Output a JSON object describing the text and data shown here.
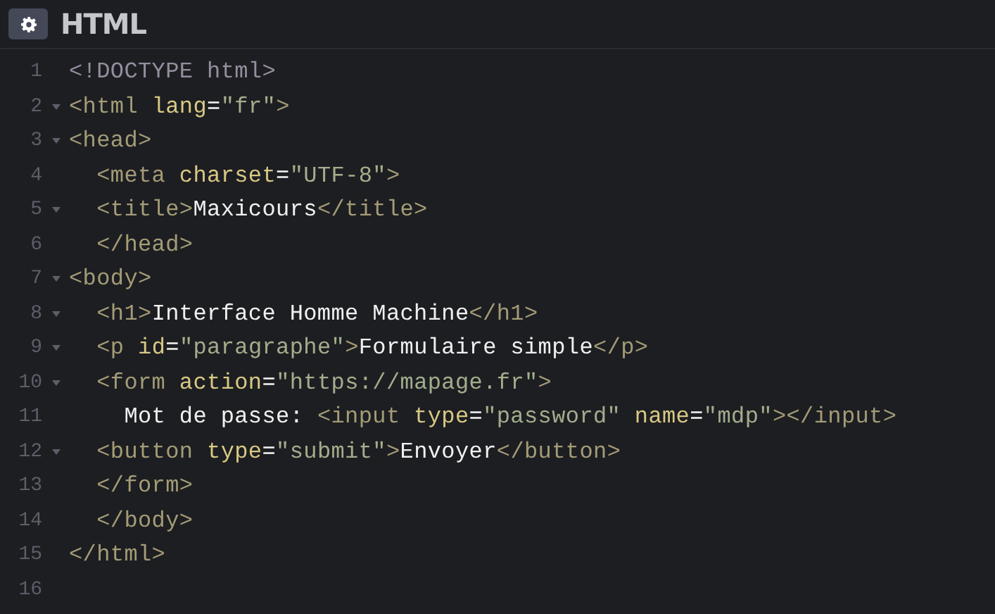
{
  "editor": {
    "title": "HTML"
  },
  "lines": [
    {
      "number": "1",
      "foldable": false,
      "tokens": [
        {
          "kind": "doctype",
          "text": "<!DOCTYPE html>"
        }
      ]
    },
    {
      "number": "2",
      "foldable": true,
      "tokens": [
        {
          "kind": "tag",
          "text": "<html"
        },
        {
          "kind": "attr",
          "text": " lang"
        },
        {
          "kind": "text",
          "text": "="
        },
        {
          "kind": "value",
          "text": "\"fr\""
        },
        {
          "kind": "tag",
          "text": ">"
        }
      ]
    },
    {
      "number": "3",
      "foldable": true,
      "tokens": [
        {
          "kind": "tag",
          "text": "<head>"
        }
      ]
    },
    {
      "number": "4",
      "foldable": false,
      "tokens": [
        {
          "kind": "tag",
          "text": "  <meta"
        },
        {
          "kind": "attr",
          "text": " charset"
        },
        {
          "kind": "text",
          "text": "="
        },
        {
          "kind": "value",
          "text": "\"UTF-8\""
        },
        {
          "kind": "tag",
          "text": ">"
        }
      ]
    },
    {
      "number": "5",
      "foldable": true,
      "tokens": [
        {
          "kind": "tag",
          "text": "  <title>"
        },
        {
          "kind": "text",
          "text": "Maxicours"
        },
        {
          "kind": "tag",
          "text": "</title>"
        }
      ]
    },
    {
      "number": "6",
      "foldable": false,
      "tokens": [
        {
          "kind": "tag",
          "text": "  </head>"
        }
      ]
    },
    {
      "number": "7",
      "foldable": true,
      "tokens": [
        {
          "kind": "tag",
          "text": "<body>"
        }
      ]
    },
    {
      "number": "8",
      "foldable": true,
      "tokens": [
        {
          "kind": "tag",
          "text": "  <h1>"
        },
        {
          "kind": "text",
          "text": "Interface Homme Machine"
        },
        {
          "kind": "tag",
          "text": "</h1>"
        }
      ]
    },
    {
      "number": "9",
      "foldable": true,
      "tokens": [
        {
          "kind": "tag",
          "text": "  <p"
        },
        {
          "kind": "attr",
          "text": " id"
        },
        {
          "kind": "text",
          "text": "="
        },
        {
          "kind": "value",
          "text": "\"paragraphe\""
        },
        {
          "kind": "tag",
          "text": ">"
        },
        {
          "kind": "text",
          "text": "Formulaire simple"
        },
        {
          "kind": "tag",
          "text": "</p>"
        }
      ]
    },
    {
      "number": "10",
      "foldable": true,
      "tokens": [
        {
          "kind": "tag",
          "text": "  <form"
        },
        {
          "kind": "attr",
          "text": " action"
        },
        {
          "kind": "text",
          "text": "="
        },
        {
          "kind": "value",
          "text": "\"https://mapage.fr\""
        },
        {
          "kind": "tag",
          "text": ">"
        }
      ]
    },
    {
      "number": "11",
      "foldable": false,
      "tokens": [
        {
          "kind": "text",
          "text": "    Mot de passe: "
        },
        {
          "kind": "tag",
          "text": "<input"
        },
        {
          "kind": "attr",
          "text": " type"
        },
        {
          "kind": "text",
          "text": "="
        },
        {
          "kind": "value",
          "text": "\"password\""
        },
        {
          "kind": "attr",
          "text": " name"
        },
        {
          "kind": "text",
          "text": "="
        },
        {
          "kind": "value",
          "text": "\"mdp\""
        },
        {
          "kind": "tag",
          "text": "></input>"
        }
      ]
    },
    {
      "number": "12",
      "foldable": true,
      "tokens": [
        {
          "kind": "tag",
          "text": "  <button"
        },
        {
          "kind": "attr",
          "text": " type"
        },
        {
          "kind": "text",
          "text": "="
        },
        {
          "kind": "value",
          "text": "\"submit\""
        },
        {
          "kind": "tag",
          "text": ">"
        },
        {
          "kind": "text",
          "text": "Envoyer"
        },
        {
          "kind": "tag",
          "text": "</button>"
        }
      ]
    },
    {
      "number": "13",
      "foldable": false,
      "tokens": [
        {
          "kind": "tag",
          "text": "  </form>"
        }
      ]
    },
    {
      "number": "14",
      "foldable": false,
      "tokens": [
        {
          "kind": "tag",
          "text": "  </body>"
        }
      ]
    },
    {
      "number": "15",
      "foldable": false,
      "tokens": [
        {
          "kind": "tag",
          "text": "</html>"
        }
      ]
    },
    {
      "number": "16",
      "foldable": false
    }
  ]
}
